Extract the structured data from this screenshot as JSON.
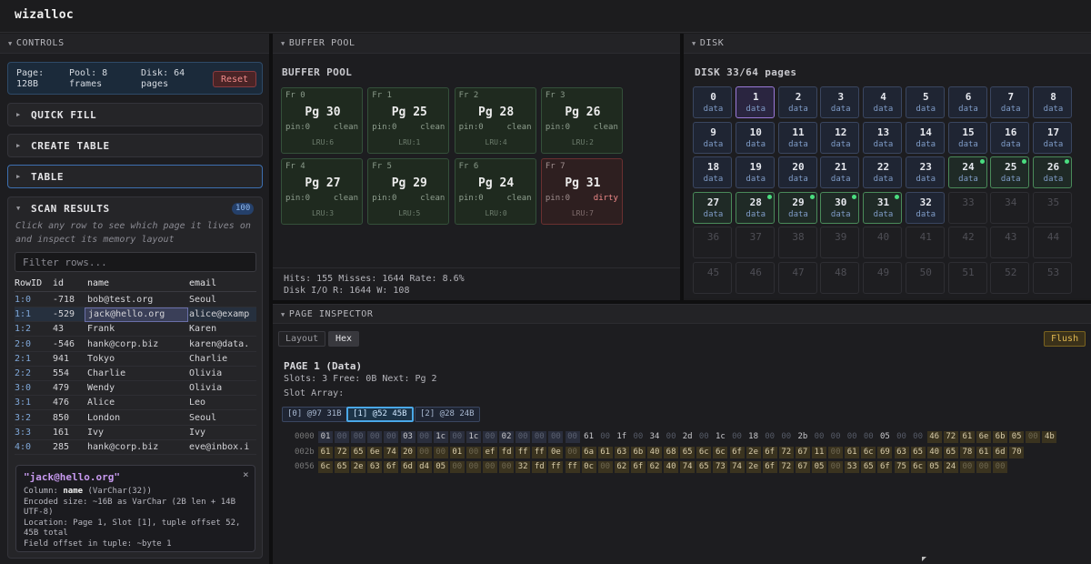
{
  "app": {
    "title": "wizalloc"
  },
  "controls": {
    "header": "CONTROLS",
    "info": {
      "page": "Page:\n128B",
      "pool": "Pool: 8\nframes",
      "disk": "Disk: 64\npages"
    },
    "reset_label": "Reset",
    "sections": [
      "QUICK FILL",
      "CREATE TABLE",
      "TABLE"
    ],
    "scan": {
      "title": "SCAN RESULTS",
      "count": "100",
      "hint": "Click any row to see which page it lives on and inspect its memory layout",
      "filter_placeholder": "Filter rows...",
      "columns": [
        "RowID",
        "id",
        "name",
        "email"
      ],
      "rows": [
        [
          "1:0",
          "-718",
          "bob@test.org",
          "Seoul"
        ],
        [
          "1:1",
          "-529",
          "jack@hello.org",
          "alice@examp"
        ],
        [
          "1:2",
          "43",
          "Frank",
          "Karen"
        ],
        [
          "2:0",
          "-546",
          "hank@corp.biz",
          "karen@data."
        ],
        [
          "2:1",
          "941",
          "Tokyo",
          "Charlie"
        ],
        [
          "2:2",
          "554",
          "Charlie",
          "Olivia"
        ],
        [
          "3:0",
          "479",
          "Wendy",
          "Olivia"
        ],
        [
          "3:1",
          "476",
          "Alice",
          "Leo"
        ],
        [
          "3:2",
          "850",
          "London",
          "Seoul"
        ],
        [
          "3:3",
          "161",
          "Ivy",
          "Ivy"
        ],
        [
          "4:0",
          "285",
          "hank@corp.biz",
          "eve@inbox.i"
        ]
      ]
    },
    "detail": {
      "value": "\"jack@hello.org\"",
      "close": "×",
      "column_prefix": "Column: ",
      "column_name": "name",
      "column_type": " (VarChar(32))",
      "encoded": "Encoded size: ~16B as VarChar (2B len + 14B UTF-8)",
      "location": "Location: Page 1, Slot [1], tuple offset 52, 45B total",
      "field_offset": "Field offset in tuple: ~byte 1"
    }
  },
  "buffer_pool": {
    "header": "BUFFER POOL",
    "title": "BUFFER POOL",
    "frames": [
      {
        "frame": "Fr 0",
        "page": "Pg 30",
        "pin": "pin:0",
        "state": "clean",
        "lru": "LRU:6"
      },
      {
        "frame": "Fr 1",
        "page": "Pg 25",
        "pin": "pin:0",
        "state": "clean",
        "lru": "LRU:1"
      },
      {
        "frame": "Fr 2",
        "page": "Pg 28",
        "pin": "pin:0",
        "state": "clean",
        "lru": "LRU:4"
      },
      {
        "frame": "Fr 3",
        "page": "Pg 26",
        "pin": "pin:0",
        "state": "clean",
        "lru": "LRU:2"
      },
      {
        "frame": "Fr 4",
        "page": "Pg 27",
        "pin": "pin:0",
        "state": "clean",
        "lru": "LRU:3"
      },
      {
        "frame": "Fr 5",
        "page": "Pg 29",
        "pin": "pin:0",
        "state": "clean",
        "lru": "LRU:5"
      },
      {
        "frame": "Fr 6",
        "page": "Pg 24",
        "pin": "pin:0",
        "state": "clean",
        "lru": "LRU:0"
      },
      {
        "frame": "Fr 7",
        "page": "Pg 31",
        "pin": "pin:0",
        "state": "dirty",
        "lru": "LRU:7"
      }
    ],
    "stats_line1": "Hits: 155  Misses: 1644  Rate: 8.6%",
    "stats_line2": "Disk I/O  R: 1644  W: 108"
  },
  "disk": {
    "header": "DISK",
    "title": "DISK  33/64 pages",
    "used_label": "data",
    "used_pages": 33,
    "visible_pages": 54,
    "current_page": 1,
    "cached_pages": [
      24,
      25,
      26,
      27,
      28,
      29,
      30,
      31
    ],
    "dot_pages": [
      24,
      25,
      26,
      28,
      29,
      30,
      31
    ]
  },
  "inspector": {
    "header": "PAGE INSPECTOR",
    "tabs": [
      "Layout",
      "Hex"
    ],
    "flush_label": "Flush",
    "page_title": "PAGE 1  (Data)",
    "meta": "Slots: 3  Free: 0B  Next: Pg 2",
    "slot_array_label": "Slot Array:",
    "slots": [
      "[0] @97 31B",
      "[1] @52 45B",
      "[2] @28 24B"
    ],
    "hex_offsets": [
      "0000",
      "002b",
      "0056"
    ],
    "hex_rows": [
      [
        "01",
        "00",
        "00",
        "00",
        "00",
        "03",
        "00",
        "1c",
        "00",
        "1c",
        "00",
        "02",
        "00",
        "00",
        "00",
        "00",
        "61",
        "00",
        "1f",
        "00",
        "34",
        "00",
        "2d",
        "00",
        "1c",
        "00",
        "18",
        "00",
        "00",
        "2b",
        "00",
        "00",
        "00",
        "00",
        "05",
        "00",
        "00",
        "46",
        "72",
        "61",
        "6e",
        "6b",
        "05",
        "00",
        "4b"
      ],
      [
        "61",
        "72",
        "65",
        "6e",
        "74",
        "20",
        "00",
        "00",
        "01",
        "00",
        "ef",
        "fd",
        "ff",
        "ff",
        "0e",
        "00",
        "6a",
        "61",
        "63",
        "6b",
        "40",
        "68",
        "65",
        "6c",
        "6c",
        "6f",
        "2e",
        "6f",
        "72",
        "67",
        "11",
        "00",
        "61",
        "6c",
        "69",
        "63",
        "65",
        "40",
        "65",
        "78",
        "61",
        "6d",
        "70"
      ],
      [
        "6c",
        "65",
        "2e",
        "63",
        "6f",
        "6d",
        "d4",
        "05",
        "00",
        "00",
        "00",
        "00",
        "32",
        "fd",
        "ff",
        "ff",
        "0c",
        "00",
        "62",
        "6f",
        "62",
        "40",
        "74",
        "65",
        "73",
        "74",
        "2e",
        "6f",
        "72",
        "67",
        "05",
        "00",
        "53",
        "65",
        "6f",
        "75",
        "6c",
        "05",
        "24",
        "00",
        "00",
        "00"
      ]
    ]
  }
}
